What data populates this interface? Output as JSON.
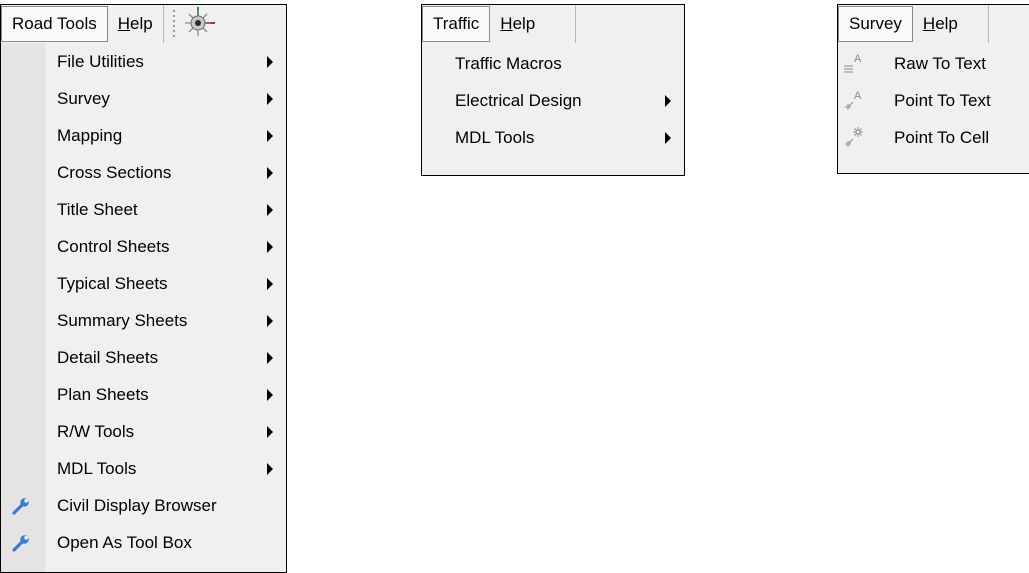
{
  "road_panel": {
    "menubar": {
      "road_tools": "Road Tools",
      "help_ul": "H",
      "help_rest": "elp"
    },
    "items": [
      {
        "label": "File Utilities"
      },
      {
        "label": "Survey"
      },
      {
        "label": "Mapping"
      },
      {
        "label": "Cross Sections"
      },
      {
        "label": "Title Sheet"
      },
      {
        "label": "Control Sheets"
      },
      {
        "label": "Typical Sheets"
      },
      {
        "label": "Summary Sheets"
      },
      {
        "label": "Detail Sheets"
      },
      {
        "label": "Plan Sheets"
      },
      {
        "label": "R/W Tools"
      },
      {
        "label": "MDL Tools"
      },
      {
        "label": "Civil Display Browser"
      },
      {
        "label": "Open As Tool Box"
      }
    ],
    "icons": {
      "gear": "gear-icon",
      "wrench": "wrench-icon",
      "submenu": "submenu-arrow-icon"
    }
  },
  "traffic_panel": {
    "menubar": {
      "traffic": "Traffic",
      "help_ul": "H",
      "help_rest": "elp"
    },
    "items": [
      {
        "label": "Traffic Macros"
      },
      {
        "label": "Electrical Design"
      },
      {
        "label": "MDL Tools"
      }
    ]
  },
  "survey_panel": {
    "menubar": {
      "survey": "Survey",
      "help_ul": "H",
      "help_rest": "elp"
    },
    "items": [
      {
        "label": "Raw To Text"
      },
      {
        "label": "Point To Text"
      },
      {
        "label": "Point To Cell"
      }
    ],
    "icons": [
      "raw-to-text-icon",
      "point-to-text-icon",
      "point-to-cell-icon"
    ]
  },
  "colors": {
    "menu_bg": "#f0f0f0",
    "gutter": "#e4e4e4",
    "wrench": "#3a7bd5"
  }
}
